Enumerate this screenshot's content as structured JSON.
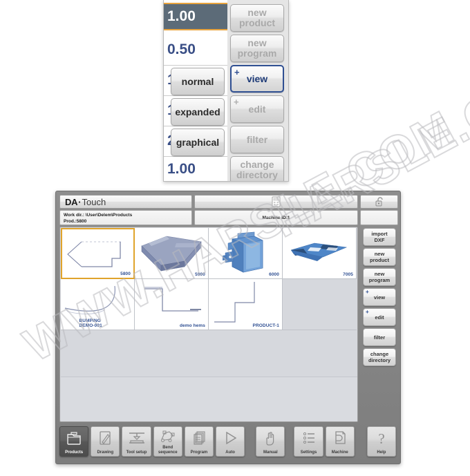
{
  "popup": {
    "values": [
      {
        "text": "1.00",
        "selected": true
      },
      {
        "text": "0.50",
        "selected": false
      },
      {
        "text": "1",
        "selected": false
      },
      {
        "text": "1",
        "selected": false
      },
      {
        "text": "2",
        "selected": false
      },
      {
        "text": "1.00",
        "selected": false
      }
    ],
    "mode_buttons": [
      {
        "label": "normal",
        "state": "enabled"
      },
      {
        "label": "expanded",
        "state": "enabled"
      },
      {
        "label": "graphical",
        "state": "enabled"
      }
    ],
    "action_buttons": [
      {
        "label": "new product",
        "line1": "new",
        "line2": "product",
        "state": "disabled",
        "plus": false
      },
      {
        "label": "new program",
        "line1": "new",
        "line2": "program",
        "state": "disabled",
        "plus": false
      },
      {
        "label": "view",
        "line1": "view",
        "line2": "",
        "state": "selected",
        "plus": true
      },
      {
        "label": "edit",
        "line1": "edit",
        "line2": "",
        "state": "disabled",
        "plus": true
      },
      {
        "label": "filter",
        "line1": "filter",
        "line2": "",
        "state": "disabled",
        "plus": false
      },
      {
        "label": "change directory",
        "line1": "change",
        "line2": "directory",
        "state": "disabled",
        "plus": false
      }
    ]
  },
  "app": {
    "titlebar": {
      "logo_da": "DA",
      "logo_dot": "·",
      "logo_touch": "Touch",
      "machine_icon": "control-panel-icon",
      "lock_icon": "unlocked-padlock-icon"
    },
    "infobar": {
      "work_dir_label": "Work dir.: \\User\\Delem\\Products",
      "prod_label": "Prod.:5800",
      "machine_id": "Machine ID:1"
    },
    "products": [
      {
        "name": "5800",
        "label_pos": "right",
        "thumb": "profile-2d-arrow",
        "selected": true
      },
      {
        "name": "5900",
        "label_pos": "right",
        "thumb": "box-3d-tray",
        "selected": false
      },
      {
        "name": "6000",
        "label_pos": "right",
        "thumb": "box-3d-cabinet",
        "selected": false
      },
      {
        "name": "7005",
        "label_pos": "right",
        "thumb": "flat-3d-plate",
        "selected": false
      },
      {
        "name": "BUMPING DEMO-001",
        "label_pos": "center",
        "thumb": "profile-2d-curve",
        "selected": false
      },
      {
        "name": "demo hems",
        "label_pos": "right",
        "thumb": "profile-2d-hem",
        "selected": false
      },
      {
        "name": "PRODUCT-1",
        "label_pos": "right",
        "thumb": "profile-2d-step",
        "selected": false
      }
    ],
    "side_buttons": [
      {
        "id": "import-dxf",
        "line1": "import",
        "line2": "DXF",
        "plus": false
      },
      {
        "id": "new-product",
        "line1": "new",
        "line2": "product",
        "plus": false
      },
      {
        "id": "new-program",
        "line1": "new",
        "line2": "program",
        "plus": false
      },
      {
        "id": "view",
        "line1": "view",
        "line2": "",
        "plus": true
      },
      {
        "id": "edit",
        "line1": "edit",
        "line2": "",
        "plus": true
      },
      {
        "id": "filter",
        "line1": "filter",
        "line2": "",
        "plus": false
      },
      {
        "id": "change-directory",
        "line1": "change",
        "line2": "directory",
        "plus": false
      }
    ],
    "toolbar": [
      {
        "id": "products",
        "line1": "Products",
        "line2": "",
        "icon": "folder-icon",
        "active": true,
        "gap": ""
      },
      {
        "id": "drawing",
        "line1": "Drawing",
        "line2": "",
        "icon": "pencil-page-icon",
        "active": false,
        "gap": ""
      },
      {
        "id": "tool-setup",
        "line1": "Tool setup",
        "line2": "",
        "icon": "press-tool-icon",
        "active": false,
        "gap": ""
      },
      {
        "id": "bend-sequence",
        "line1": "Bend",
        "line2": "sequence",
        "icon": "bend-path-icon",
        "active": false,
        "gap": ""
      },
      {
        "id": "program",
        "line1": "Program",
        "line2": "",
        "icon": "stacked-pages-icon",
        "active": false,
        "gap": ""
      },
      {
        "id": "auto",
        "line1": "Auto",
        "line2": "",
        "icon": "play-triangle-icon",
        "active": false,
        "gap": ""
      },
      {
        "id": "manual",
        "line1": "Manual",
        "line2": "",
        "icon": "hand-icon",
        "active": false,
        "gap": "gap"
      },
      {
        "id": "settings",
        "line1": "Settings",
        "line2": "",
        "icon": "list-settings-icon",
        "active": false,
        "gap": "gap2"
      },
      {
        "id": "machine",
        "line1": "Machine",
        "line2": "",
        "icon": "machine-page-icon",
        "active": false,
        "gap": ""
      },
      {
        "id": "help",
        "line1": "Help",
        "line2": "",
        "icon": "question-mark-icon",
        "active": false,
        "gap": "gap3"
      }
    ]
  },
  "watermark": {
    "line1": "WWW.HARSLE.COM",
    "line2": "HARSLE.COM"
  },
  "colors": {
    "selection_orange": "#e0a32b",
    "accent_blue": "#2f4f92",
    "label_blue": "#2f4f92",
    "window_grey": "#7d7d7d",
    "content_grey": "#d6d8dd",
    "selected_row": "#5c6b78"
  }
}
